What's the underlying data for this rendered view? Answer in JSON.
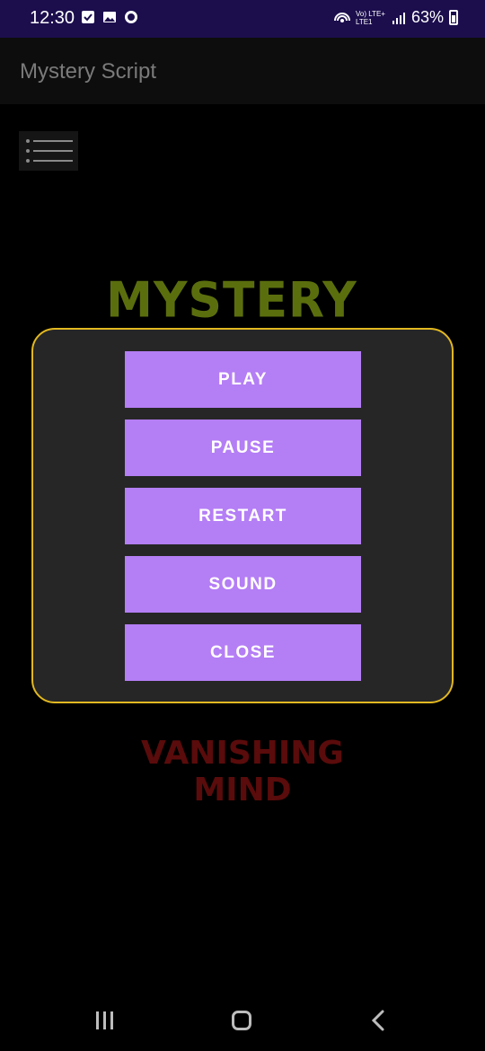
{
  "status_bar": {
    "time": "12:30",
    "network": "Vo) LTE+ LTE1",
    "battery": "63%",
    "icons": [
      "checkbox-icon",
      "image-icon",
      "whatsapp-icon",
      "hotspot-icon",
      "signal-icon",
      "battery-icon"
    ]
  },
  "app_bar": {
    "title": "Mystery Script"
  },
  "menu": {
    "icon": "hamburger-menu-icon"
  },
  "logo": {
    "title": "MYSTERY SCRIPT",
    "subtitle": "VANISHING MIND"
  },
  "dialog": {
    "buttons": [
      {
        "label": "PLAY"
      },
      {
        "label": "PAUSE"
      },
      {
        "label": "RESTART"
      },
      {
        "label": "SOUND"
      },
      {
        "label": "CLOSE"
      }
    ]
  },
  "nav_bar": {
    "icons": [
      "recent-apps-icon",
      "home-icon",
      "back-icon"
    ]
  },
  "colors": {
    "accent_button": "#b47ef5",
    "dialog_border": "#e2b821",
    "dialog_bg": "#262626",
    "logo_title": "#5b6e0e",
    "logo_subtitle": "#5a0b0b",
    "status_bar_bg": "#1c0e4d"
  }
}
